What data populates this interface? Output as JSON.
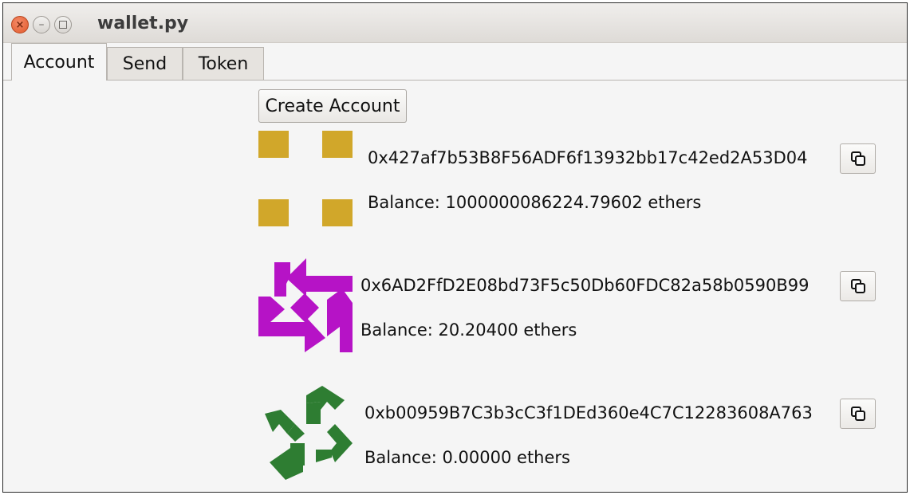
{
  "window": {
    "title": "wallet.py"
  },
  "icons": {
    "close": "close-icon",
    "minimize": "minimize-icon",
    "maximize": "maximize-icon",
    "copy": "copy-icon",
    "close_glyph": "×",
    "minimize_glyph": "–"
  },
  "tabs": [
    {
      "label": "Account",
      "active": true
    },
    {
      "label": "Send",
      "active": false
    },
    {
      "label": "Token",
      "active": false
    }
  ],
  "account_tab": {
    "create_button": "Create Account",
    "accounts": [
      {
        "address": "0x427af7b53B8F56ADF6f13932bb17c42ed2A53D04",
        "balance": "Balance: 1000000086224.79602 ethers",
        "identicon_color": "#d1a72a"
      },
      {
        "address": "0x6AD2FfD2E08bd73F5c50Db60FDC82a58b0590B99",
        "balance": "Balance: 20.20400 ethers",
        "identicon_color": "#b613c6"
      },
      {
        "address": "0xb00959B7C3b3cC3f1DEd360e4C7C12283608A763",
        "balance": "Balance: 0.00000 ethers",
        "identicon_color": "#2e7d32"
      }
    ]
  },
  "colors": {
    "titlebar": "#e4e1dd",
    "close_button": "#e05a2c",
    "window_background": "#f5f5f5"
  }
}
